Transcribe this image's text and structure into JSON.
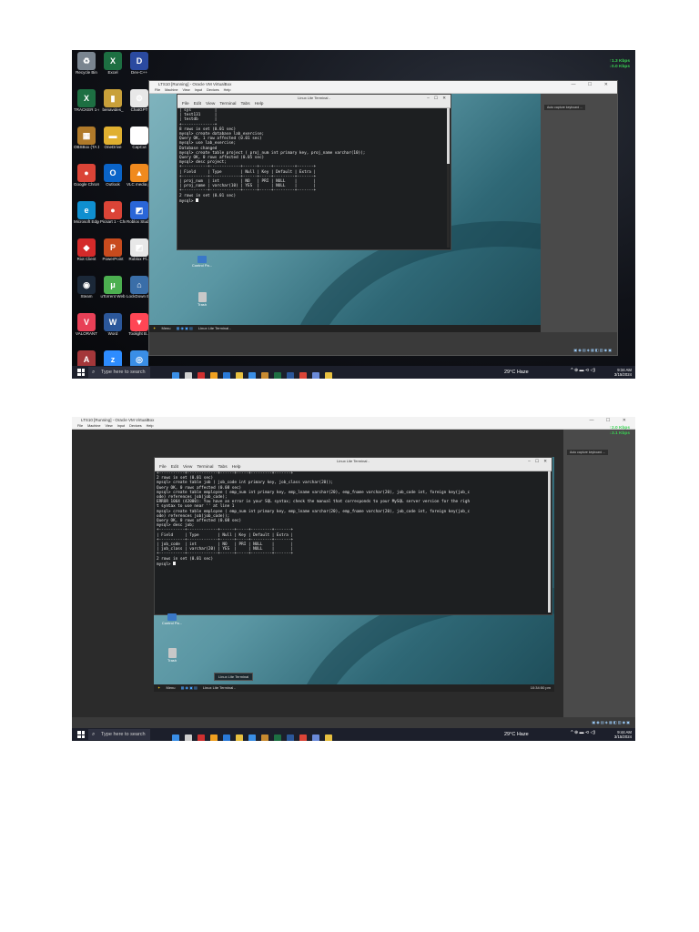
{
  "screens": [
    {
      "desktop_icons": [
        {
          "label": "Recycle Bin",
          "color": "#7a8590",
          "glyph": "♻"
        },
        {
          "label": "Excel",
          "color": "#1d6f42",
          "glyph": "X"
        },
        {
          "label": "Dev-C++",
          "color": "#2b4aa0",
          "glyph": "D"
        },
        {
          "label": "TRACKER 1-4",
          "color": "#1d6f42",
          "glyph": "X"
        },
        {
          "label": "benavides_",
          "color": "#c8a03a",
          "glyph": "▮"
        },
        {
          "label": "ChatGPT",
          "color": "#e8e8e8",
          "glyph": "⚙"
        },
        {
          "label": "OBSBox (TA 1)",
          "color": "#b07a2a",
          "glyph": "▦"
        },
        {
          "label": "OneDrive",
          "color": "#e0b030",
          "glyph": "▬"
        },
        {
          "label": "CapCut",
          "color": "#ffffff",
          "glyph": "✂"
        },
        {
          "label": "Google Chrome",
          "color": "#db4437",
          "glyph": "●"
        },
        {
          "label": "Outlook",
          "color": "#0a64c8",
          "glyph": "O"
        },
        {
          "label": "VLC media player",
          "color": "#f08a1e",
          "glyph": "▲"
        },
        {
          "label": "Microsoft Edge",
          "color": "#0f8fd0",
          "glyph": "e"
        },
        {
          "label": "Picsart 1 - Chrome",
          "color": "#db4437",
          "glyph": "●"
        },
        {
          "label": "Roblox Studio",
          "color": "#2a66d8",
          "glyph": "◩"
        },
        {
          "label": "Riot Client",
          "color": "#d42a2a",
          "glyph": "◆"
        },
        {
          "label": "PowerPoint",
          "color": "#c84b1e",
          "glyph": "P"
        },
        {
          "label": "Roblox Pl...",
          "color": "#e8e8e8",
          "glyph": "◩"
        },
        {
          "label": "Steam",
          "color": "#1b2838",
          "glyph": "◉"
        },
        {
          "label": "uTorrent Web",
          "color": "#4caf50",
          "glyph": "μ"
        },
        {
          "label": "LockDown Browser",
          "color": "#3a6ea8",
          "glyph": "⌂"
        },
        {
          "label": "VALORANT",
          "color": "#e84057",
          "glyph": "V"
        },
        {
          "label": "Word",
          "color": "#2b579a",
          "glyph": "W"
        },
        {
          "label": "Toolight B...",
          "color": "#ff4655",
          "glyph": "▼"
        },
        {
          "label": "Access",
          "color": "#a4373a",
          "glyph": "A"
        },
        {
          "label": "Zoom",
          "color": "#2d8cff",
          "glyph": "z"
        },
        {
          "label": "Desktop...",
          "color": "#3a8ee6",
          "glyph": "◎"
        }
      ],
      "vm_title": "LTS10 [Running] - Oracle VM VirtualBox",
      "vm_menu": [
        "File",
        "Machine",
        "View",
        "Input",
        "Devices",
        "Help"
      ],
      "terminal_title": "Linux Lite Terminal -",
      "terminal_menu": [
        "File",
        "Edit",
        "View",
        "Terminal",
        "Tabs",
        "Help"
      ],
      "terminal_lines": [
        "| sys          |",
        "| test131      |",
        "| testdb       |",
        "+--------------+",
        "8 rows in set (0.01 sec)",
        "",
        "mysql> create database lab_exercise;",
        "Query OK, 1 row affected (0.01 sec)",
        "",
        "mysql> use lab_exercise;",
        "Database changed",
        "mysql> create table project ( proj_num int primary key, proj_name varchar(10));",
        "Query OK, 0 rows affected (0.05 sec)",
        "",
        "mysql> desc project;",
        "+-----------+-------------+------+-----+---------+-------+",
        "| Field     | Type        | Null | Key | Default | Extra |",
        "+-----------+-------------+------+-----+---------+-------+",
        "| proj_num  | int         | NO   | PRI | NULL    |       |",
        "| proj_name | varchar(10) | YES  |     | NULL    |       |",
        "+-----------+-------------+------+-----+---------+-------+",
        "2 rows in set (0.01 sec)",
        "",
        "mysql> "
      ],
      "guest_desktop_icons": [
        "Control Pa...",
        "Trash"
      ],
      "guest_taskbar": [
        "Menu",
        "Linux Lite Terminal -"
      ],
      "side_notification": "Auto capture keyboard ...",
      "network": [
        "↑1.3 Kbps",
        "↓0.0 Kbps"
      ],
      "search_placeholder": "Type here to search",
      "weather": "29°C Haze",
      "time": "9:34 AM",
      "date": "3/15/2024"
    },
    {
      "vm_title": "LTS10 [Running] - Oracle VM VirtualBox",
      "vm_menu": [
        "File",
        "Machine",
        "View",
        "Input",
        "Devices",
        "Help"
      ],
      "terminal_title": "Linux Lite Terminal -",
      "terminal_menu": [
        "File",
        "Edit",
        "View",
        "Terminal",
        "Tabs",
        "Help"
      ],
      "terminal_lines": [
        "+-----------+-------------+------+-----+---------+-------+",
        "2 rows in set (0.01 sec)",
        "",
        "mysql> create table job ( job_code int primary key, job_class varchar(20));",
        "Query OK, 0 rows affected (0.08 sec)",
        "",
        "mysql> create table employee ( emp_num int primary key, emp_lname varchar(20), emp_fname varchar(20), job_code int, foreign key(job_c",
        "ode) references job(job_code);",
        "ERROR 1064 (42000): You have an error in your SQL syntax; check the manual that corresponds to your MySQL server version for the righ",
        "t syntax to use near '' at line 1",
        "mysql> create table employee ( emp_num int primary key, emp_lname varchar(20), emp_fname varchar(20), job_code int, foreign key(job_c",
        "ode) references job(job_code));",
        "Query OK, 0 rows affected (0.08 sec)",
        "",
        "mysql> desc job;",
        "+-----------+-------------+------+-----+---------+-------+",
        "| Field     | Type        | Null | Key | Default | Extra |",
        "+-----------+-------------+------+-----+---------+-------+",
        "| job_code  | int         | NO   | PRI | NULL    |       |",
        "| job_class | varchar(20) | YES  |     | NULL    |       |",
        "+-----------+-------------+------+-----+---------+-------+",
        "2 rows in set (0.01 sec)",
        "",
        "mysql> "
      ],
      "guest_desktop_icons": [
        "Control Pa...",
        "Trash"
      ],
      "guest_taskbar": [
        "Menu",
        "Linux Lite Terminal -"
      ],
      "tooltip": "Linux Lite Terminal",
      "guest_clock": "10:34:50 pm",
      "side_notification": "Auto capture keyboard ...",
      "network": [
        "↑2.0 Kbps",
        "↓3.1 Kbps"
      ],
      "search_placeholder": "Type here to search",
      "weather": "29°C Haze",
      "time": "9:44 AM",
      "date": "3/15/2024"
    }
  ],
  "colors": {
    "terminal_bg": "#1d1f21",
    "terminal_text": "#e8e8e8",
    "net_green": "#39d353",
    "win_taskbar": "#1c1f2b",
    "guest_wallpaper": "#5a96a3"
  }
}
